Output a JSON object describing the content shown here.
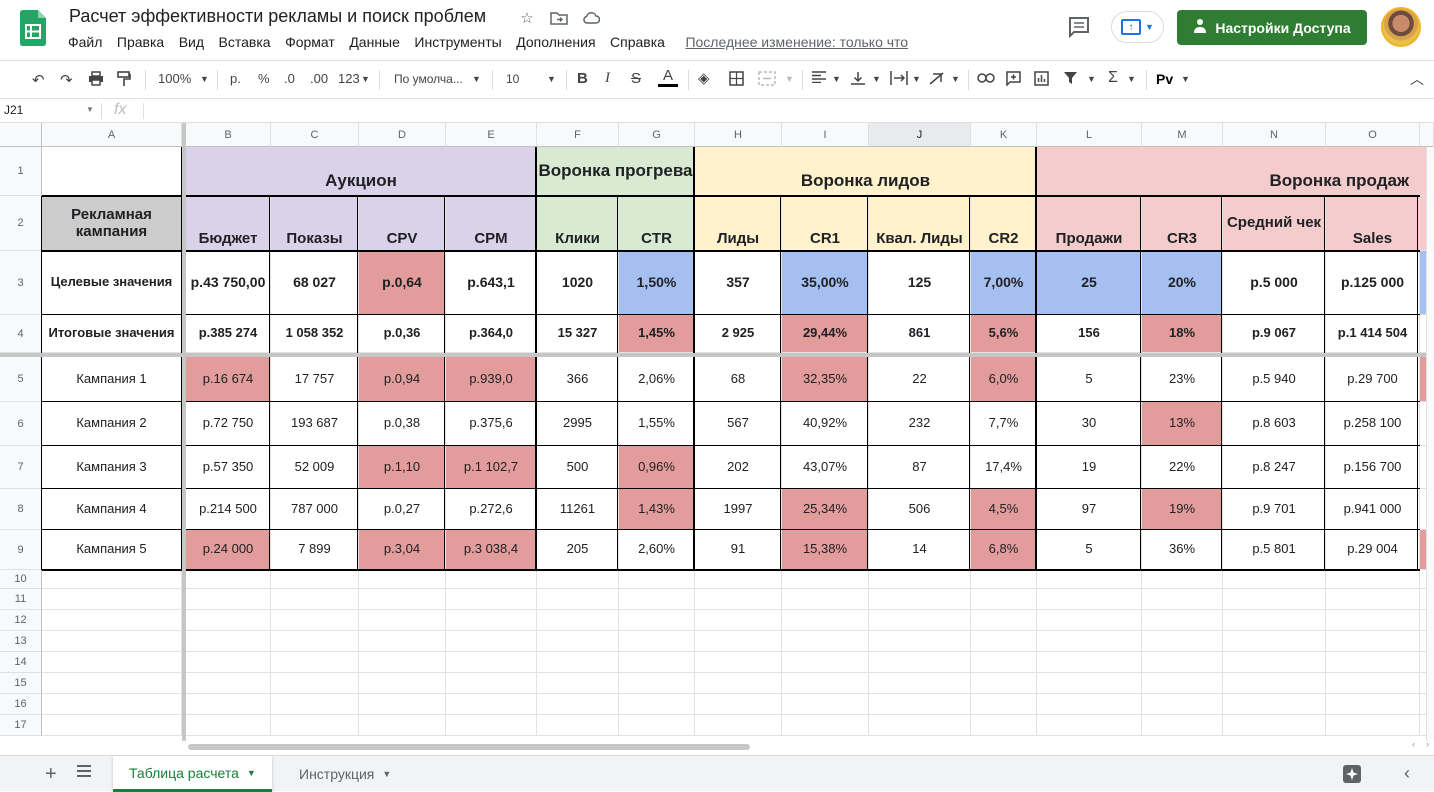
{
  "doc": {
    "title": "Расчет эффективности рекламы и поиск проблем",
    "menu": [
      "Файл",
      "Правка",
      "Вид",
      "Вставка",
      "Формат",
      "Данные",
      "Инструменты",
      "Дополнения",
      "Справка"
    ],
    "last_edit": "Последнее изменение: только что",
    "share_label": "Настройки Доступа"
  },
  "toolbar": {
    "zoom": "100%",
    "currency": "р.",
    "percent": "%",
    "dec_less": ".0",
    "dec_more": ".00",
    "format_more": "123",
    "font": "По умолча...",
    "font_size": "10"
  },
  "formula_bar": {
    "cell_ref": "J21",
    "fx": "fx"
  },
  "columns": [
    "A",
    "B",
    "C",
    "D",
    "E",
    "F",
    "G",
    "H",
    "I",
    "J",
    "K",
    "L",
    "M",
    "N",
    "O"
  ],
  "rows": [
    "1",
    "2",
    "3",
    "4",
    "5",
    "6",
    "7",
    "8",
    "9",
    "10",
    "11",
    "12",
    "13",
    "14",
    "15",
    "16",
    "17"
  ],
  "groups": {
    "auction": "Аукцион",
    "warmup": "Воронка прогрева",
    "leads": "Воронка лидов",
    "sales": "Воронка продаж"
  },
  "headers": {
    "campaign": "Рекламная кампания",
    "budget": "Бюджет",
    "impressions": "Показы",
    "cpv": "CPV",
    "cpm": "CPM",
    "clicks": "Клики",
    "ctr": "CTR",
    "leads": "Лиды",
    "cr1": "CR1",
    "qual_leads": "Квал. Лиды",
    "cr2": "CR2",
    "sales_count": "Продажи",
    "cr3": "CR3",
    "avg_check": "Средний чек",
    "sales": "Sales"
  },
  "data_rows": [
    {
      "label": "Целевые значения",
      "values": [
        "р.43 750,00",
        "68 027",
        "р.0,64",
        "р.643,1",
        "1020",
        "1,50%",
        "357",
        "35,00%",
        "125",
        "7,00%",
        "25",
        "20%",
        "р.5 000",
        "р.125 000"
      ]
    },
    {
      "label": "Итоговые значения",
      "values": [
        "р.385 274",
        "1 058 352",
        "р.0,36",
        "р.364,0",
        "15 327",
        "1,45%",
        "2 925",
        "29,44%",
        "861",
        "5,6%",
        "156",
        "18%",
        "р.9 067",
        "р.1 414 504"
      ]
    },
    {
      "label": "Кампания 1",
      "values": [
        "р.16 674",
        "17 757",
        "р.0,94",
        "р.939,0",
        "366",
        "2,06%",
        "68",
        "32,35%",
        "22",
        "6,0%",
        "5",
        "23%",
        "р.5 940",
        "р.29 700"
      ]
    },
    {
      "label": "Кампания 2",
      "values": [
        "р.72 750",
        "193 687",
        "р.0,38",
        "р.375,6",
        "2995",
        "1,55%",
        "567",
        "40,92%",
        "232",
        "7,7%",
        "30",
        "13%",
        "р.8 603",
        "р.258 100"
      ]
    },
    {
      "label": "Кампания 3",
      "values": [
        "р.57 350",
        "52 009",
        "р.1,10",
        "р.1 102,7",
        "500",
        "0,96%",
        "202",
        "43,07%",
        "87",
        "17,4%",
        "19",
        "22%",
        "р.8 247",
        "р.156 700"
      ]
    },
    {
      "label": "Кампания 4",
      "values": [
        "р.214 500",
        "787 000",
        "р.0,27",
        "р.272,6",
        "11261",
        "1,43%",
        "1997",
        "25,34%",
        "506",
        "4,5%",
        "97",
        "19%",
        "р.9 701",
        "р.941 000"
      ]
    },
    {
      "label": "Кампания 5",
      "values": [
        "р.24 000",
        "7 899",
        "р.3,04",
        "р.3 038,4",
        "205",
        "2,60%",
        "91",
        "15,38%",
        "14",
        "6,8%",
        "5",
        "36%",
        "р.5 801",
        "р.29 004"
      ]
    }
  ],
  "highlights": {
    "red": "#e19c9b",
    "blue": "#a4bff0",
    "auction_bg": "#d9d2e9",
    "warmup_bg": "#d9ead3",
    "leads_bg": "#fff2cc",
    "sales_bg": "#f4cccc"
  },
  "sheets": [
    "Таблица расчета",
    "Инструкция"
  ]
}
